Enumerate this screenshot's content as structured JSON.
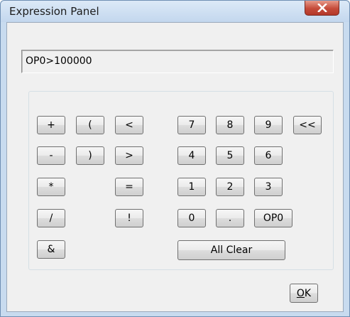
{
  "window": {
    "title": "Expression Panel"
  },
  "expression": {
    "value": "OP0>100000"
  },
  "operators": {
    "plus": "+",
    "open_paren": "(",
    "less": "<",
    "minus": "-",
    "close_paren": ")",
    "greater": ">",
    "multiply": "*",
    "equals": "=",
    "divide": "/",
    "not": "!",
    "and": "&"
  },
  "keypad": {
    "seven": "7",
    "eight": "8",
    "nine": "9",
    "backspace": "<<",
    "four": "4",
    "five": "5",
    "six": "6",
    "one": "1",
    "two": "2",
    "three": "3",
    "zero": "0",
    "dot": ".",
    "op0": "OP0",
    "all_clear": "All Clear"
  },
  "dialog": {
    "ok_mnemonic": "O",
    "ok_rest": "K"
  }
}
